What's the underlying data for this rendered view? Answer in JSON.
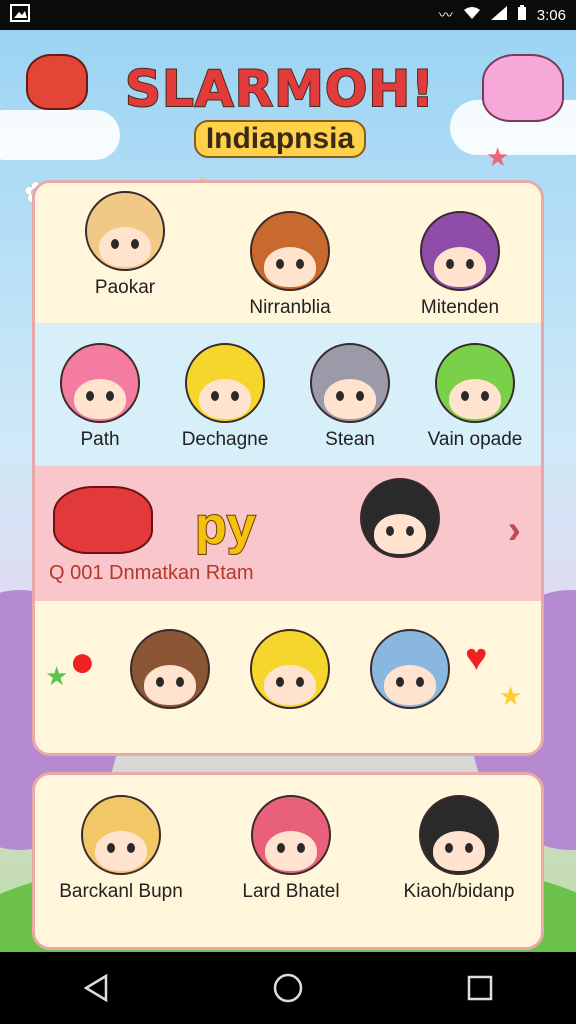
{
  "status_bar": {
    "time": "3:06"
  },
  "logo": {
    "title": "SLARMOH!",
    "subtitle": "Indiapnsia"
  },
  "colors": {
    "accent": "#f4c20d",
    "board_bg": "#fff6dc",
    "row_blue": "#d7eff8",
    "row_pink": "#f9c6cc",
    "border": "#e9a9a9"
  },
  "rows": [
    {
      "characters": [
        {
          "name": "Paokar",
          "hair": "#f0c987"
        },
        {
          "name": "Nirranblia",
          "hair": "#c86a2e"
        },
        {
          "name": "Mitenden",
          "hair": "#8f4ca8"
        }
      ]
    },
    {
      "characters": [
        {
          "name": "Path",
          "hair": "#f37ca0"
        },
        {
          "name": "Dechagne",
          "hair": "#f5d62d"
        },
        {
          "name": "Stean",
          "hair": "#9a9aa8"
        },
        {
          "name": "Vain opade",
          "hair": "#7bd04a"
        }
      ]
    }
  ],
  "promo": {
    "badge_text": "py",
    "caption": "Q 001 Dnmatkan Rtam",
    "arrow_icon": "chevron-right-icon"
  },
  "row4": {
    "characters": [
      {
        "hair": "#8a5636"
      },
      {
        "hair": "#f5d62d"
      },
      {
        "hair": "#8ab7e0"
      }
    ]
  },
  "bottom": {
    "characters": [
      {
        "name": "Barckanl Bupn",
        "hair": "#f2c766"
      },
      {
        "name": "Lard Bhatel",
        "hair": "#e8607a"
      },
      {
        "name": "Kiaoh/bidanp",
        "hair": "#2a2a2a"
      }
    ]
  },
  "nav": {
    "back": "back-icon",
    "home": "home-icon",
    "recents": "recents-icon"
  }
}
